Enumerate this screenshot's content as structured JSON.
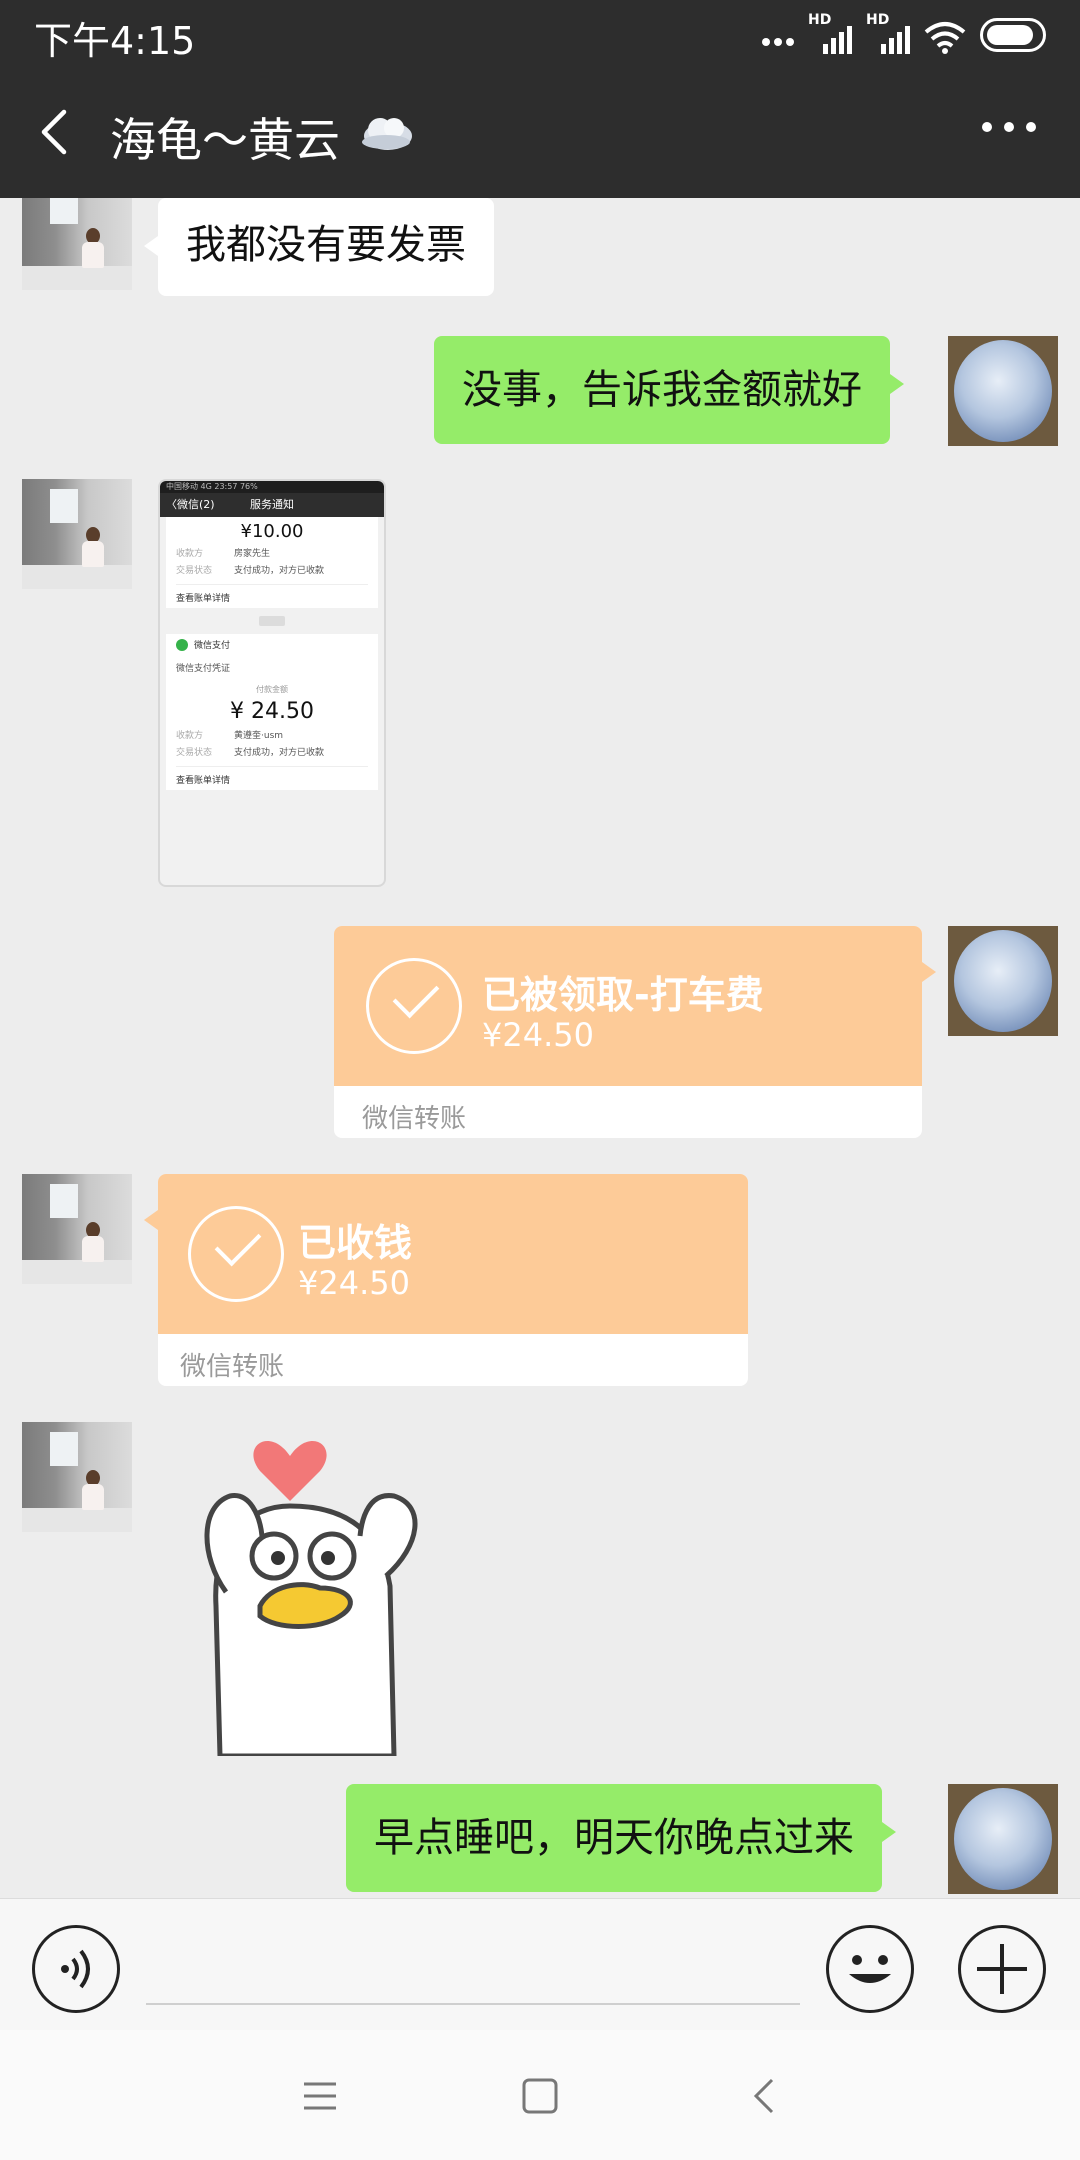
{
  "status_bar": {
    "time": "下午4:15",
    "hd1": "HD",
    "hd2": "HD"
  },
  "header": {
    "title": "海龟～黄云"
  },
  "messages": {
    "m1": "我都没有要发票",
    "m2": "没事，告诉我金额就好",
    "m7": "早点睡吧，明天你晚点过来"
  },
  "screenshot": {
    "status": "中国移动 4G   23:57   76%",
    "back": "〈微信(2)",
    "nav_title": "服务通知",
    "top_amount": "¥10.00",
    "recv_key": "收款方",
    "recv_val_1": "房家先生",
    "status_key": "交易状态",
    "status_val": "支付成功，对方已收款",
    "details": "查看账单详情",
    "pay_name": "微信支付",
    "voucher": "微信支付凭证",
    "amount_label": "付款金额",
    "amount": "¥ 24.50",
    "recv_val_2": "黄遵奎·usm"
  },
  "transfer_sent": {
    "label": "已被领取-打车费",
    "amount": "¥24.50",
    "footer": "微信转账"
  },
  "transfer_recv": {
    "label": "已收钱",
    "amount": "¥24.50",
    "footer": "微信转账"
  },
  "colors": {
    "header_bg": "#2d2d2d",
    "chat_bg": "#ededed",
    "bubble_self": "#95ec69",
    "bubble_other": "#ffffff",
    "transfer": "#fdcb98"
  }
}
